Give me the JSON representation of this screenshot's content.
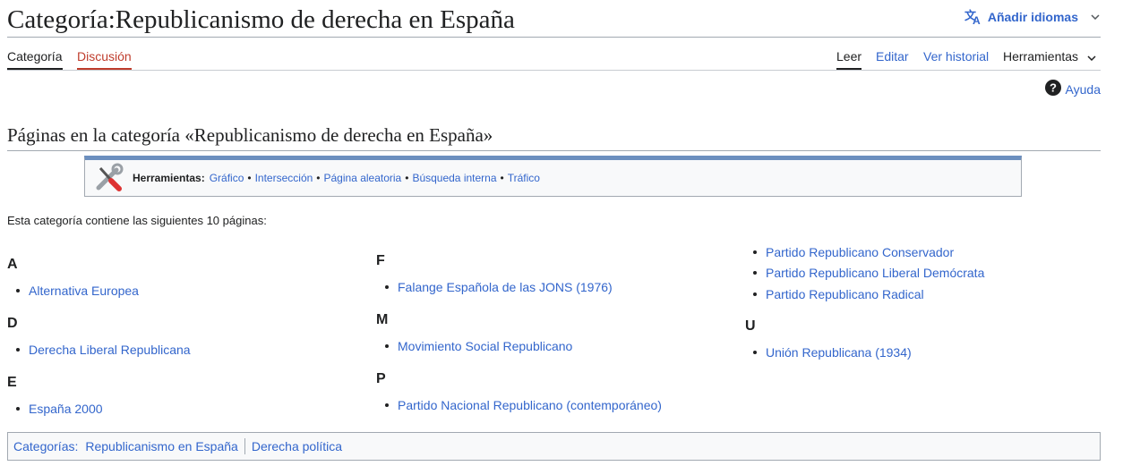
{
  "page": {
    "title": "Categoría:Republicanismo de derecha en España",
    "add_languages": "Añadir idiomas"
  },
  "tabs": {
    "category": "Categoría",
    "discussion": "Discusión",
    "read": "Leer",
    "edit": "Editar",
    "history": "Ver historial",
    "tools": "Herramientas"
  },
  "help": "Ayuda",
  "section_heading": "Páginas en la categoría «Republicanismo de derecha en España»",
  "toolbox": {
    "label": "Herramientas:",
    "links": [
      "Gráfico",
      "Intersección",
      "Página aleatoria",
      "Búsqueda interna",
      "Tráfico"
    ]
  },
  "intro": "Esta categoría contiene las siguientes 10 páginas:",
  "groups": {
    "A": {
      "letter": "A",
      "items": [
        "Alternativa Europea"
      ]
    },
    "D": {
      "letter": "D",
      "items": [
        "Derecha Liberal Republicana"
      ]
    },
    "E": {
      "letter": "E",
      "items": [
        "España 2000"
      ]
    },
    "F": {
      "letter": "F",
      "items": [
        "Falange Española de las JONS (1976)"
      ]
    },
    "M": {
      "letter": "M",
      "items": [
        "Movimiento Social Republicano"
      ]
    },
    "P": {
      "letter": "P",
      "items": [
        "Partido Nacional Republicano (contemporáneo)",
        "Partido Republicano Conservador",
        "Partido Republicano Liberal Demócrata",
        "Partido Republicano Radical"
      ]
    },
    "U": {
      "letter": "U",
      "items": [
        "Unión Republicana (1934)"
      ]
    }
  },
  "catlinks": {
    "label": "Categorías:",
    "items": [
      "Republicanismo en España",
      "Derecha política"
    ]
  },
  "colors": {
    "link": "#3366cc",
    "text": "#202122",
    "discussion_tab": "#bf3c2c",
    "toolbox_bar": "#6c8fbf",
    "box_bg": "#f8f9fa"
  }
}
